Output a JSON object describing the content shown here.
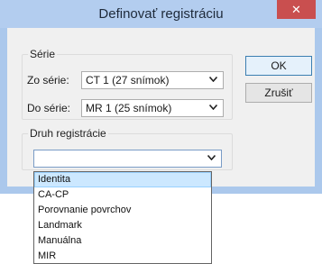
{
  "window": {
    "title": "Definovať registráciu",
    "close_glyph": "✕"
  },
  "serie_group": {
    "label": "Série",
    "from_label": "Zo série:",
    "from_value": "CT 1 (27 snímok)",
    "to_label": "Do série:",
    "to_value": "MR 1 (25 snímok)"
  },
  "druh_group": {
    "label": "Druh registrácie",
    "selected_value": ""
  },
  "buttons": {
    "ok": "OK",
    "cancel": "Zrušiť"
  },
  "dropdown_items": [
    "Identita",
    "CA-CP",
    "Porovnanie povrchov",
    "Landmark",
    "Manuálna",
    "MIR"
  ],
  "dropdown_highlighted": "Identita",
  "icons": {
    "chevron": "❯"
  },
  "colors": {
    "title_bar": "#b3cdef",
    "close_button": "#c94f4f",
    "selection": "#cce8ff"
  }
}
